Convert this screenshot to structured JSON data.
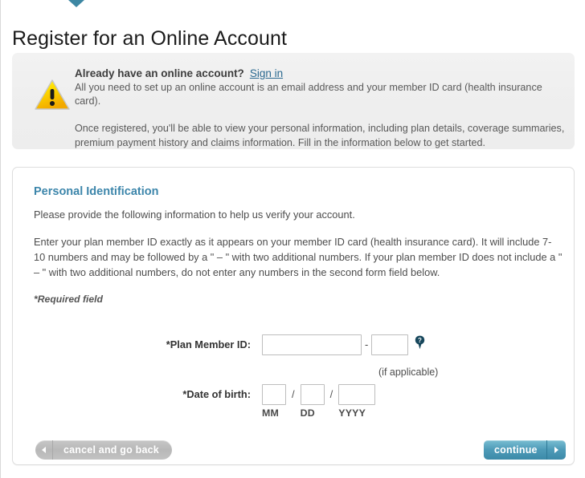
{
  "page": {
    "title": "Register for an Online Account"
  },
  "alert": {
    "icon": "warning-triangle-icon",
    "heading": "Already have an online account?",
    "signin_link": "Sign in",
    "line1": "All you need to set up an online account is an email address and your member ID card (health insurance card).",
    "paragraph": "Once registered, you'll be able to view your personal information, including plan details, coverage summaries, premium payment history and claims information. Fill in the information below to get started."
  },
  "form": {
    "section_title": "Personal Identification",
    "intro": "Please provide the following information to help us verify your account.",
    "instructions": "Enter your plan member ID exactly as it appears on your member ID card (health insurance card). It will include 7-10 numbers and may be followed by a \" – \" with two additional numbers. If your plan member ID does not include a \" – \" with two additional numbers, do not enter any numbers in the second form field below.",
    "required_note": "*Required field",
    "member_id": {
      "label": "*Plan Member ID:",
      "value": "",
      "placeholder": "",
      "separator": "-",
      "suffix_value": "",
      "suffix_placeholder": "",
      "help_icon": "help-question-pin-icon",
      "hint": "(if applicable)"
    },
    "dob": {
      "label": "*Date of birth:",
      "separator": "/",
      "month": {
        "value": "",
        "hint": "MM"
      },
      "day": {
        "value": "",
        "hint": "DD"
      },
      "year": {
        "value": "",
        "hint": "YYYY"
      }
    }
  },
  "buttons": {
    "back": "cancel and go back",
    "continue": "continue"
  },
  "colors": {
    "accent_teal": "#3d86ab",
    "link_blue": "#29688f",
    "pointer_arrow": "#3d87a3",
    "warning_yellow": "#ffdd00",
    "continue_button": "#4e9bb8",
    "back_button": "#bdbdbd",
    "panel_gray": "#efefef"
  }
}
